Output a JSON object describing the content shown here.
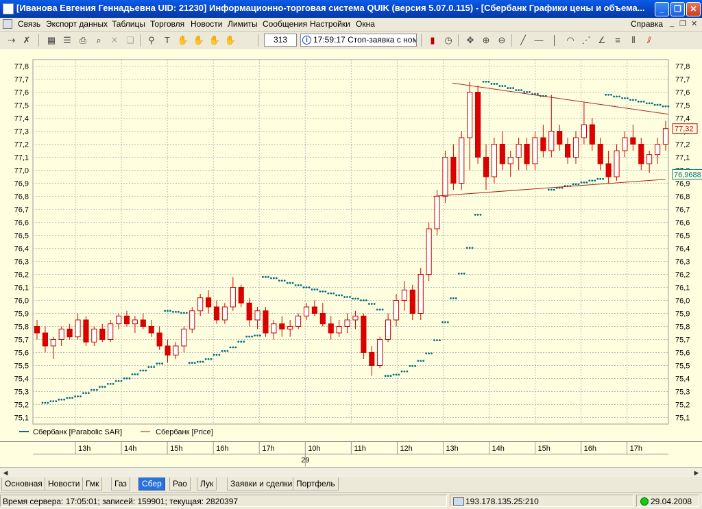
{
  "window": {
    "title": "[Иванова Евгения Геннадьевна  UID: 21230] Информационно-торговая система QUIK (версия 5.07.0.115) - [Сбербанк Графики цены и объема...",
    "min": "_",
    "max": "❐",
    "close": "✕"
  },
  "menu": {
    "items": [
      "Связь",
      "Экспорт данных",
      "Таблицы",
      "Торговля",
      "Новости",
      "Лимиты",
      "Сообщения",
      "Настройки",
      "Окна"
    ],
    "help": "Справка"
  },
  "toolbar": {
    "count": "313",
    "status": "17:59:17  Стоп-заявка с номе"
  },
  "chart_data": {
    "type": "candlestick",
    "y_ticks": [
      "77,8",
      "77,7",
      "77,6",
      "77,5",
      "77,4",
      "77,3",
      "77,2",
      "77,1",
      "77,0",
      "76,9",
      "76,8",
      "76,7",
      "76,6",
      "76,5",
      "76,4",
      "76,3",
      "76,2",
      "76,1",
      "76,0",
      "75,9",
      "75,8",
      "75,7",
      "75,6",
      "75,5",
      "75,4",
      "75,3",
      "75,2",
      "75,1"
    ],
    "ylim": [
      75.05,
      77.85
    ],
    "series": [
      {
        "name": "Сбербанк [Parabolic SAR]",
        "color": "#007080"
      },
      {
        "name": "Сбербанк [Price]",
        "color": "#cc0000"
      }
    ],
    "last_price_label": "77,32",
    "last_sar_label": "76,9688",
    "x_ticks": [
      "13h",
      "14h",
      "15h",
      "16h",
      "17h",
      "10h",
      "11h",
      "12h",
      "13h",
      "14h",
      "15h",
      "16h",
      "17h"
    ],
    "date_label": "29",
    "candles": [
      [
        75.8,
        75.85,
        75.7,
        75.75
      ],
      [
        75.75,
        75.8,
        75.6,
        75.65
      ],
      [
        75.65,
        75.72,
        75.55,
        75.7
      ],
      [
        75.7,
        75.8,
        75.65,
        75.78
      ],
      [
        75.78,
        75.82,
        75.7,
        75.72
      ],
      [
        75.72,
        75.9,
        75.7,
        75.85
      ],
      [
        75.85,
        75.88,
        75.65,
        75.68
      ],
      [
        75.68,
        75.8,
        75.65,
        75.78
      ],
      [
        75.78,
        75.82,
        75.68,
        75.7
      ],
      [
        75.7,
        75.85,
        75.68,
        75.82
      ],
      [
        75.82,
        75.9,
        75.78,
        75.88
      ],
      [
        75.88,
        75.92,
        75.8,
        75.82
      ],
      [
        75.82,
        75.88,
        75.75,
        75.85
      ],
      [
        75.85,
        75.9,
        75.78,
        75.8
      ],
      [
        75.8,
        75.85,
        75.72,
        75.75
      ],
      [
        75.75,
        75.8,
        75.62,
        75.65
      ],
      [
        75.65,
        75.7,
        75.52,
        75.58
      ],
      [
        75.58,
        75.68,
        75.55,
        75.65
      ],
      [
        75.65,
        75.8,
        75.6,
        75.78
      ],
      [
        75.78,
        75.95,
        75.75,
        75.92
      ],
      [
        75.92,
        76.05,
        75.88,
        76.02
      ],
      [
        76.02,
        76.08,
        75.9,
        75.95
      ],
      [
        75.95,
        76.0,
        75.82,
        75.85
      ],
      [
        75.85,
        75.98,
        75.82,
        75.95
      ],
      [
        75.95,
        76.18,
        75.92,
        76.1
      ],
      [
        76.1,
        76.12,
        75.95,
        75.98
      ],
      [
        75.98,
        76.02,
        75.8,
        75.85
      ],
      [
        75.85,
        75.95,
        75.78,
        75.92
      ],
      [
        75.92,
        75.95,
        75.72,
        75.75
      ],
      [
        75.75,
        75.85,
        75.7,
        75.82
      ],
      [
        75.82,
        75.88,
        75.72,
        75.78
      ],
      [
        75.78,
        75.85,
        75.72,
        75.8
      ],
      [
        75.8,
        75.9,
        75.78,
        75.88
      ],
      [
        75.88,
        75.98,
        75.85,
        75.95
      ],
      [
        75.95,
        76.0,
        75.88,
        75.9
      ],
      [
        75.9,
        75.98,
        75.8,
        75.82
      ],
      [
        75.82,
        75.88,
        75.7,
        75.75
      ],
      [
        75.75,
        75.85,
        75.72,
        75.8
      ],
      [
        75.8,
        75.9,
        75.75,
        75.85
      ],
      [
        75.85,
        75.92,
        75.78,
        75.88
      ],
      [
        75.88,
        75.9,
        75.55,
        75.6
      ],
      [
        75.6,
        75.65,
        75.42,
        75.5
      ],
      [
        75.5,
        75.72,
        75.48,
        75.7
      ],
      [
        75.7,
        75.9,
        75.68,
        75.85
      ],
      [
        75.85,
        76.05,
        75.8,
        76.0
      ],
      [
        76.0,
        76.15,
        75.92,
        76.08
      ],
      [
        76.08,
        76.12,
        75.85,
        75.9
      ],
      [
        75.9,
        76.25,
        75.85,
        76.2
      ],
      [
        76.2,
        76.6,
        76.15,
        76.55
      ],
      [
        76.55,
        76.85,
        76.5,
        76.8
      ],
      [
        76.8,
        77.15,
        76.75,
        77.1
      ],
      [
        77.1,
        77.2,
        76.85,
        76.9
      ],
      [
        76.9,
        77.3,
        76.85,
        77.25
      ],
      [
        77.25,
        77.68,
        77.0,
        77.6
      ],
      [
        77.6,
        77.65,
        77.05,
        77.1
      ],
      [
        77.1,
        77.2,
        76.85,
        76.95
      ],
      [
        76.95,
        77.25,
        76.9,
        77.2
      ],
      [
        77.2,
        77.3,
        77.0,
        77.05
      ],
      [
        77.05,
        77.15,
        76.95,
        77.1
      ],
      [
        77.1,
        77.25,
        77.0,
        77.2
      ],
      [
        77.2,
        77.25,
        77.0,
        77.05
      ],
      [
        77.05,
        77.3,
        77.0,
        77.25
      ],
      [
        77.25,
        77.35,
        77.1,
        77.15
      ],
      [
        77.15,
        77.58,
        77.1,
        77.3
      ],
      [
        77.3,
        77.35,
        77.15,
        77.2
      ],
      [
        77.2,
        77.25,
        77.05,
        77.1
      ],
      [
        77.1,
        77.3,
        77.05,
        77.25
      ],
      [
        77.25,
        77.52,
        77.2,
        77.35
      ],
      [
        77.35,
        77.4,
        77.15,
        77.2
      ],
      [
        77.2,
        77.25,
        77.0,
        77.05
      ],
      [
        77.05,
        77.15,
        76.9,
        76.95
      ],
      [
        76.95,
        77.2,
        76.92,
        77.15
      ],
      [
        77.15,
        77.3,
        77.1,
        77.25
      ],
      [
        77.25,
        77.35,
        77.15,
        77.2
      ],
      [
        77.2,
        77.25,
        77.0,
        77.05
      ],
      [
        77.05,
        77.15,
        76.98,
        77.12
      ],
      [
        77.12,
        77.25,
        77.05,
        77.2
      ],
      [
        77.2,
        77.38,
        77.15,
        77.32
      ]
    ],
    "trend_lines": [
      {
        "x1": 0.66,
        "y1": 77.67,
        "x2": 1.0,
        "y2": 77.43
      },
      {
        "x1": 0.63,
        "y1": 76.8,
        "x2": 0.995,
        "y2": 76.93
      }
    ]
  },
  "time_axis": {},
  "tabs": [
    "Основная",
    "Новости",
    "Гмк",
    "Газ",
    "Сбер",
    "Рао",
    "Лук",
    "Заявки и сделки",
    "Портфель"
  ],
  "active_tab": "Сбер",
  "status": {
    "server": "Время сервера: 17:05:01; записей: 159901; текущая: 2820397",
    "ip": "193.178.135.25:210",
    "date": "29.04.2008"
  }
}
